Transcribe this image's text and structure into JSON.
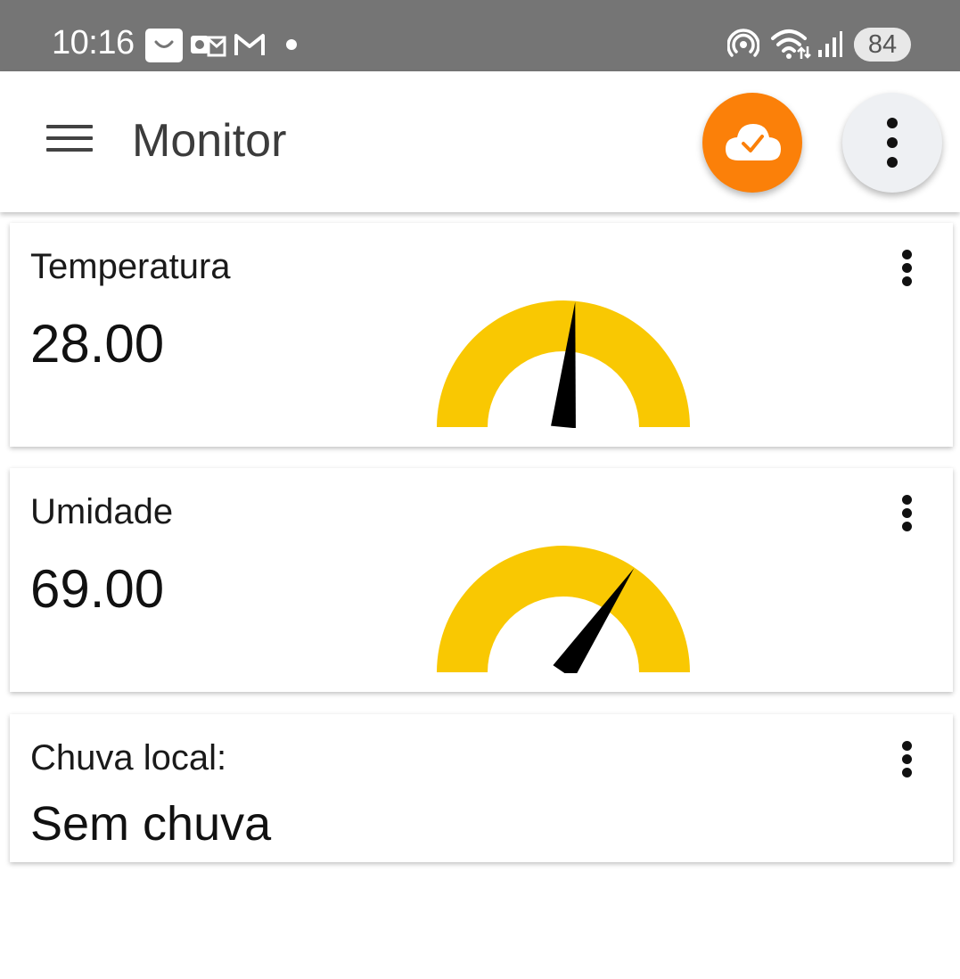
{
  "status_bar": {
    "time": "10:16",
    "battery": "84",
    "icons": [
      "shopping-bag-icon",
      "outlook-icon",
      "gmail-icon",
      "notification-dot-icon",
      "hotspot-icon",
      "wifi-icon",
      "signal-icon"
    ]
  },
  "app_bar": {
    "title": "Monitor",
    "menu_icon": "hamburger-menu-icon",
    "cloud_icon": "cloud-check-icon",
    "more_icon": "more-vert-icon"
  },
  "colors": {
    "status_bar": "#757575",
    "accent_orange": "#fb8009",
    "gauge_yellow": "#f9c802",
    "needle": "#000000"
  },
  "widgets": [
    {
      "label": "Temperatura",
      "value": "28.00",
      "gauge_level": 0.53
    },
    {
      "label": "Umidade",
      "value": "69.00",
      "gauge_level": 0.69
    },
    {
      "label": "Chuva local:",
      "value": "Sem chuva"
    }
  ]
}
